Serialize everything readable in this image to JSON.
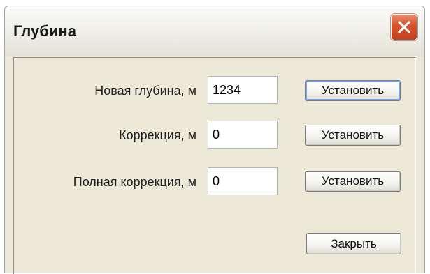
{
  "window": {
    "title": "Глубина"
  },
  "rows": [
    {
      "label": "Новая глубина, м",
      "value": "1234",
      "button": "Установить"
    },
    {
      "label": "Коррекция, м",
      "value": "0",
      "button": "Установить"
    },
    {
      "label": "Полная коррекция, м",
      "value": "0",
      "button": "Установить"
    }
  ],
  "footer": {
    "close_label": "Закрыть"
  },
  "icons": {
    "close": "close-icon"
  },
  "colors": {
    "dialog_bg": "#ece9d8",
    "close_button": "#d5532d"
  }
}
